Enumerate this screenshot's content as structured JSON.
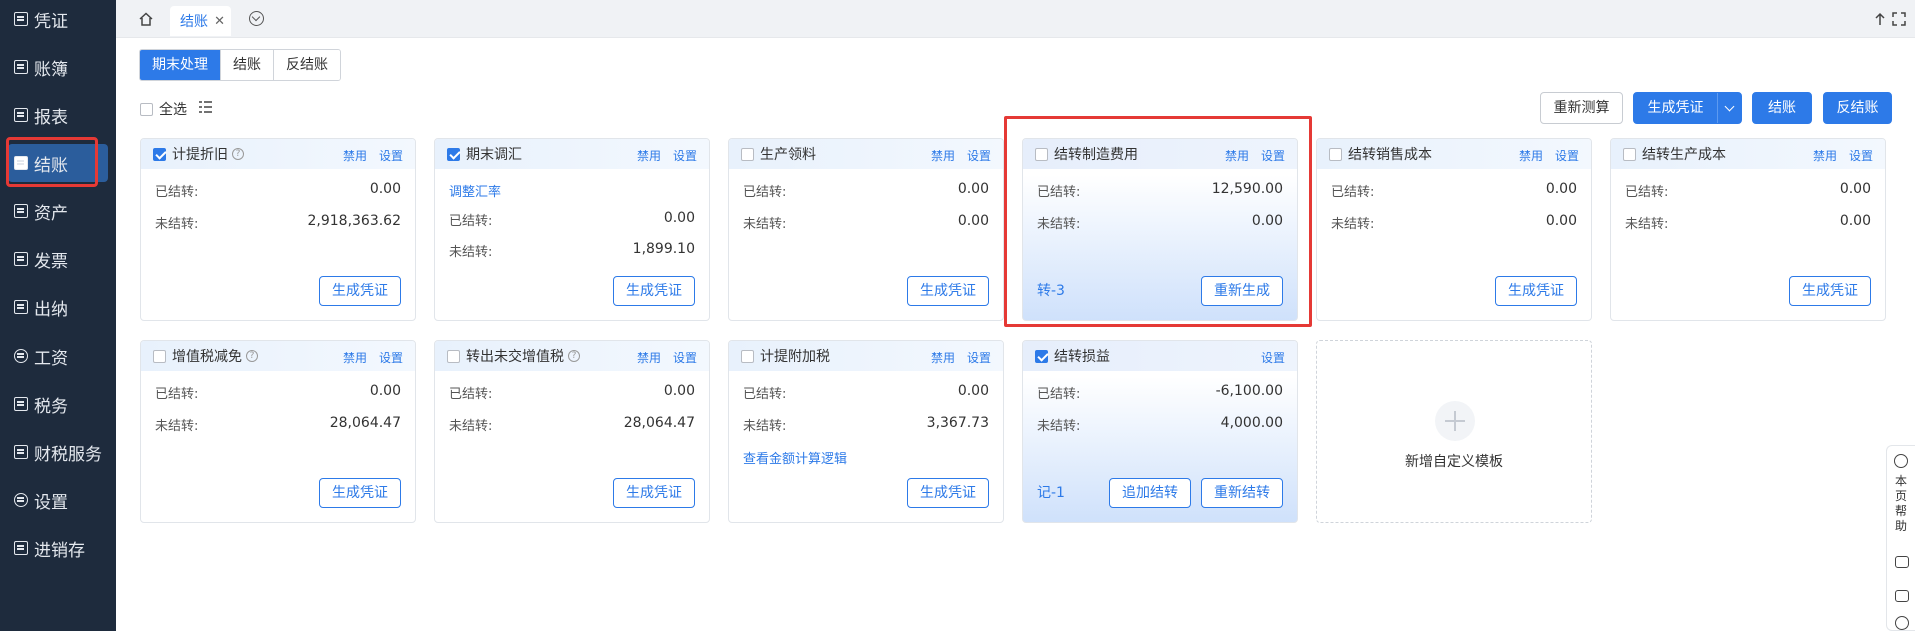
{
  "sidebar": {
    "items": [
      {
        "label": "凭证",
        "icon": "voucher-icon"
      },
      {
        "label": "账簿",
        "icon": "ledger-icon"
      },
      {
        "label": "报表",
        "icon": "report-icon"
      },
      {
        "label": "结账",
        "icon": "closing-icon",
        "active": true
      },
      {
        "label": "资产",
        "icon": "asset-icon"
      },
      {
        "label": "发票",
        "icon": "invoice-icon"
      },
      {
        "label": "出纳",
        "icon": "cashier-icon"
      },
      {
        "label": "工资",
        "icon": "salary-icon"
      },
      {
        "label": "税务",
        "icon": "tax-icon"
      },
      {
        "label": "财税服务",
        "icon": "service-icon"
      },
      {
        "label": "设置",
        "icon": "settings-icon"
      },
      {
        "label": "进销存",
        "icon": "inventory-icon"
      }
    ]
  },
  "topbar": {
    "tab_label": "结账",
    "close_glyph": "✕"
  },
  "segments": [
    "期末处理",
    "结账",
    "反结账"
  ],
  "toolbar": {
    "select_all": "全选",
    "recalc": "重新测算",
    "generate_voucher": "生成凭证",
    "close_account": "结账",
    "reverse_close": "反结账"
  },
  "cards": {
    "c1": {
      "title": "计提折旧",
      "disable": "禁用",
      "settings": "设置",
      "done_label": "已结转:",
      "done_value": "0.00",
      "pending_label": "未结转:",
      "pending_value": "2,918,363.62",
      "button": "生成凭证"
    },
    "c2": {
      "title": "期末调汇",
      "disable": "禁用",
      "settings": "设置",
      "link": "调整汇率",
      "done_label": "已结转:",
      "done_value": "0.00",
      "pending_label": "未结转:",
      "pending_value": "1,899.10",
      "button": "生成凭证"
    },
    "c3": {
      "title": "生产领料",
      "disable": "禁用",
      "settings": "设置",
      "done_label": "已结转:",
      "done_value": "0.00",
      "pending_label": "未结转:",
      "pending_value": "0.00",
      "button": "生成凭证"
    },
    "c4": {
      "title": "结转制造费用",
      "disable": "禁用",
      "settings": "设置",
      "done_label": "已结转:",
      "done_value": "12,590.00",
      "pending_label": "未结转:",
      "pending_value": "0.00",
      "voucher": "转-3",
      "button": "重新生成"
    },
    "c5": {
      "title": "结转销售成本",
      "disable": "禁用",
      "settings": "设置",
      "done_label": "已结转:",
      "done_value": "0.00",
      "pending_label": "未结转:",
      "pending_value": "0.00",
      "button": "生成凭证"
    },
    "c6": {
      "title": "结转生产成本",
      "disable": "禁用",
      "settings": "设置",
      "done_label": "已结转:",
      "done_value": "0.00",
      "pending_label": "未结转:",
      "pending_value": "0.00",
      "button": "生成凭证"
    },
    "c7": {
      "title": "增值税减免",
      "disable": "禁用",
      "settings": "设置",
      "done_label": "已结转:",
      "done_value": "0.00",
      "pending_label": "未结转:",
      "pending_value": "28,064.47",
      "button": "生成凭证"
    },
    "c8": {
      "title": "转出未交增值税",
      "disable": "禁用",
      "settings": "设置",
      "done_label": "已结转:",
      "done_value": "0.00",
      "pending_label": "未结转:",
      "pending_value": "28,064.47",
      "button": "生成凭证"
    },
    "c9": {
      "title": "计提附加税",
      "disable": "禁用",
      "settings": "设置",
      "done_label": "已结转:",
      "done_value": "0.00",
      "pending_label": "未结转:",
      "pending_value": "3,367.73",
      "link": "查看金额计算逻辑",
      "button": "生成凭证"
    },
    "c10": {
      "title": "结转损益",
      "settings": "设置",
      "done_label": "已结转:",
      "done_value": "-6,100.00",
      "pending_label": "未结转:",
      "pending_value": "4,000.00",
      "voucher": "记-1",
      "button_add": "追加结转",
      "button": "重新结转"
    },
    "add": {
      "label": "新增自定义模板"
    }
  },
  "float_help": {
    "label": "本页帮助"
  },
  "colors": {
    "primary": "#2d7ae8",
    "sidebar": "#1e2b3d",
    "highlight": "#e53935"
  }
}
